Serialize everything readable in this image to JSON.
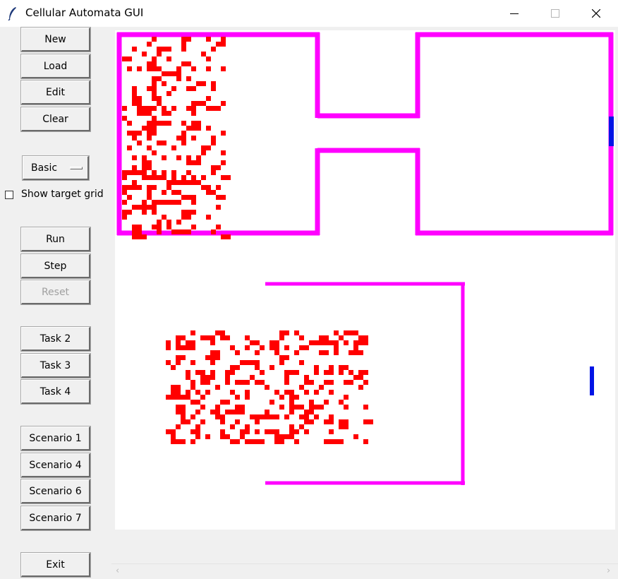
{
  "window": {
    "title": "Cellular Automata GUI",
    "minimize_glyph": "—",
    "maximize_glyph": "☐",
    "close_glyph": "✕"
  },
  "sidebar": {
    "file_buttons": {
      "new": "New",
      "load": "Load",
      "edit": "Edit",
      "clear": "Clear"
    },
    "mode_select": {
      "selected": "Basic"
    },
    "show_target_grid": {
      "label": "Show target grid",
      "checked": false
    },
    "sim_buttons": {
      "run": "Run",
      "step": "Step",
      "reset": "Reset"
    },
    "tasks": {
      "task2": "Task 2",
      "task3": "Task 3",
      "task4": "Task 4"
    },
    "scenarios": {
      "s1": "Scenario 1",
      "s4": "Scenario 4",
      "s6": "Scenario 6",
      "s7": "Scenario 7"
    },
    "exit": "Exit"
  },
  "scrollbar": {
    "left_arrow": "‹",
    "right_arrow": "›"
  },
  "colors": {
    "wall": "#ff00ff",
    "agent": "#ff0000",
    "target": "#0014e6",
    "canvas_bg": "#ffffff",
    "window_bg": "#f0f0f0"
  },
  "icons": [
    "feather-icon",
    "minimize-icon",
    "maximize-icon",
    "close-icon",
    "scroll-left-icon",
    "scroll-right-icon",
    "dropdown-indicator-icon"
  ]
}
